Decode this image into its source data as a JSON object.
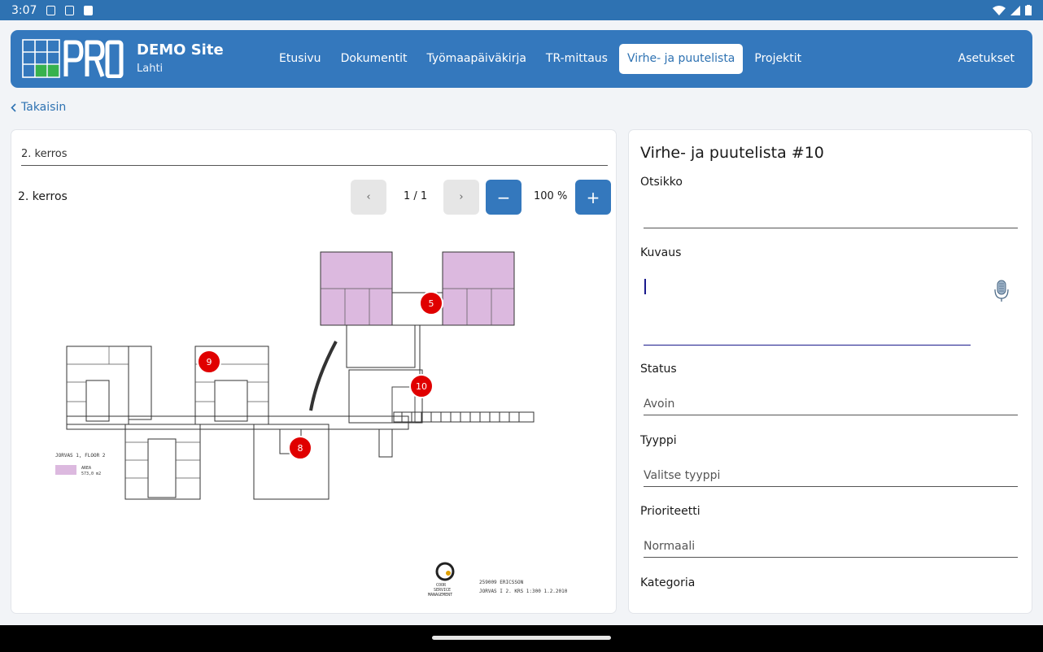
{
  "status_bar": {
    "time": "3:07"
  },
  "header": {
    "site_title": "DEMO Site",
    "site_subtitle": "Lahti",
    "nav": [
      "Etusivu",
      "Dokumentit",
      "Työmaapäiväkirja",
      "TR-mittaus",
      "Virhe- ja puutelista",
      "Projektit"
    ],
    "active_nav": "Virhe- ja puutelista",
    "settings": "Asetukset"
  },
  "back_link": "Takaisin",
  "plan_view": {
    "selected_plan": "2. kerros",
    "plan_name": "2. kerros",
    "prev": "‹",
    "next": "›",
    "page": "1 / 1",
    "zoom_out": "−",
    "zoom_in": "+",
    "zoom": "100 %",
    "markers": [
      "5",
      "9",
      "10",
      "8"
    ],
    "legend_title": "JORVAS 1, FLOOR 2",
    "legend_area_label": "AREA",
    "legend_area_value": "573,0 m2",
    "company_line1": "COOR",
    "company_line2": "SERVICE",
    "company_line3": "MANAGEMENT",
    "drawing_line1": "259009 ERICSSON",
    "drawing_line2": "JORVAS  I   2. KRS 1:300 1.2.2010"
  },
  "form": {
    "title": "Virhe- ja puutelista #10",
    "fields": {
      "otsikko": {
        "label": "Otsikko",
        "value": ""
      },
      "kuvaus": {
        "label": "Kuvaus",
        "value": ""
      },
      "status": {
        "label": "Status",
        "value": "Avoin"
      },
      "tyyppi": {
        "label": "Tyyppi",
        "placeholder": "Valitse tyyppi"
      },
      "prioriteetti": {
        "label": "Prioriteetti",
        "value": "Normaali"
      },
      "kategoria": {
        "label": "Kategoria"
      }
    }
  },
  "colors": {
    "brand": "#3478bd",
    "marker": "#e00000",
    "room_fill": "#dcb9df"
  }
}
